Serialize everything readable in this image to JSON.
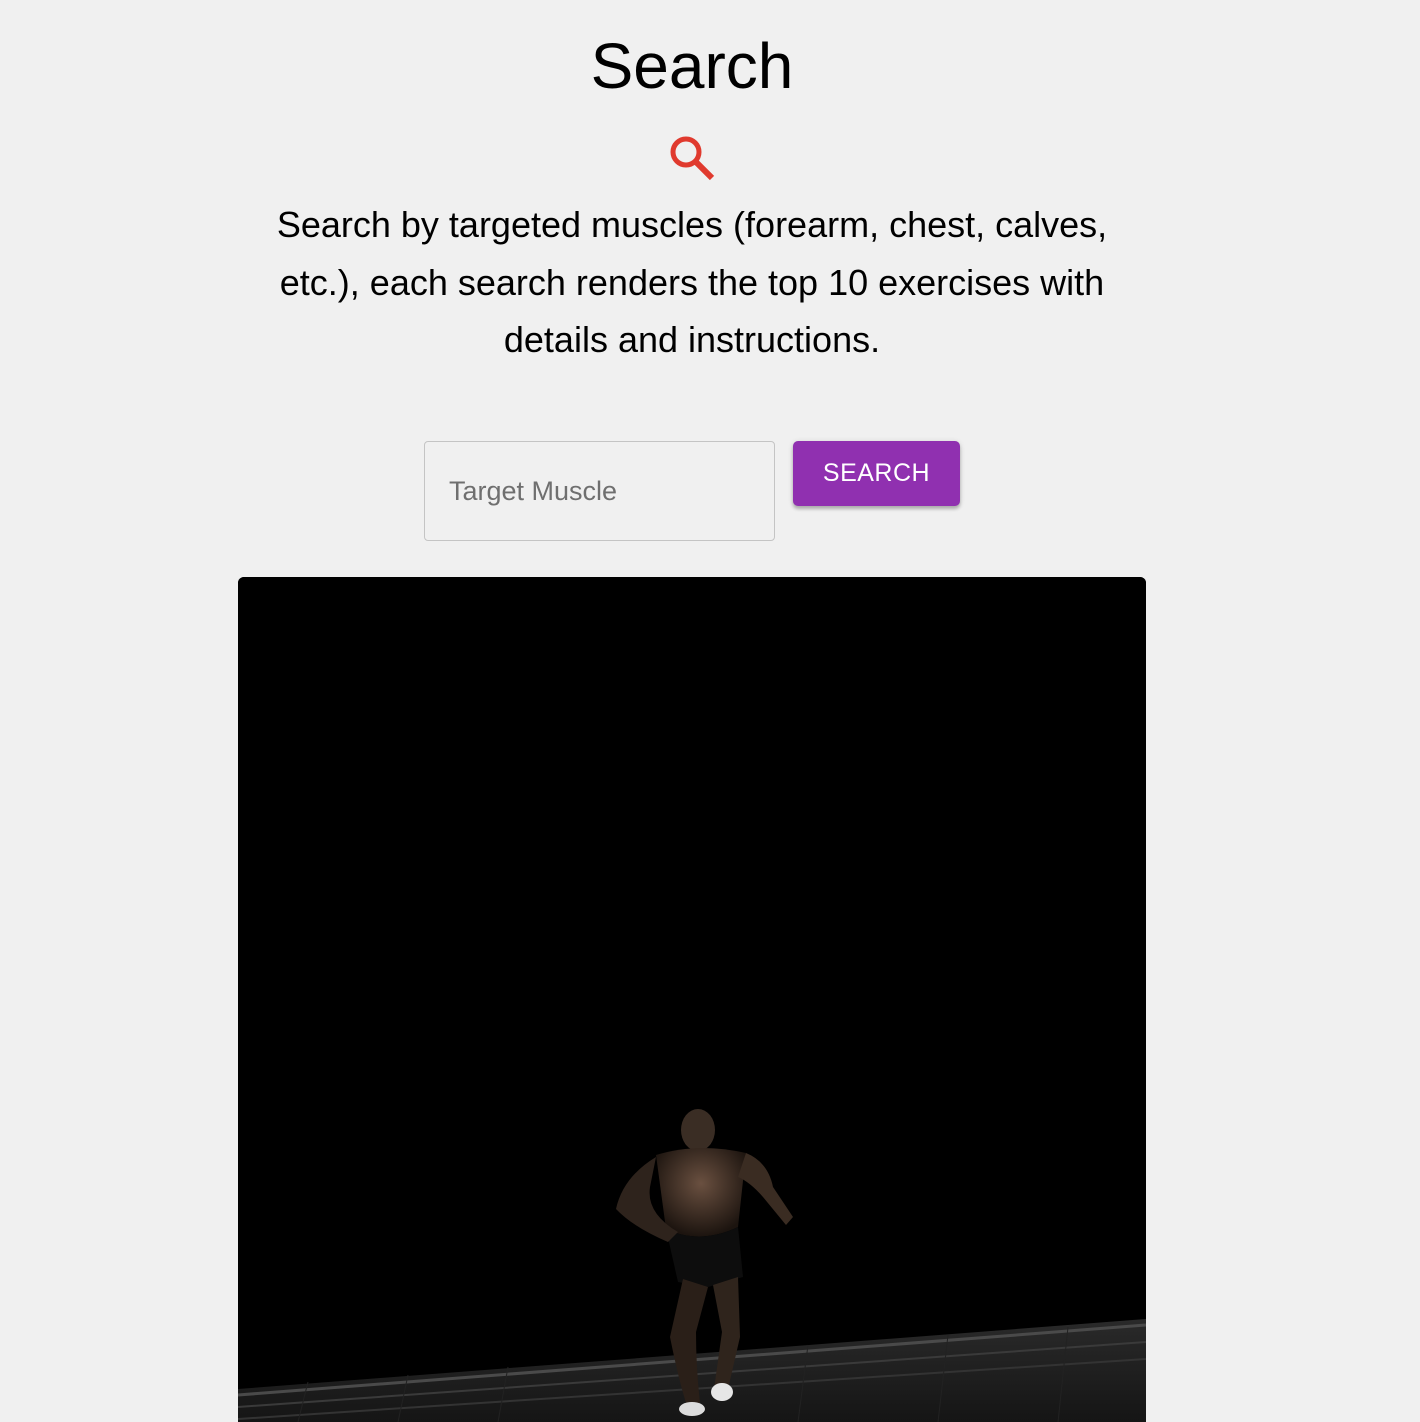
{
  "header": {
    "title": "Search",
    "icon": "search-icon",
    "icon_color": "#e03a2e"
  },
  "intro": {
    "description": "Search by targeted muscles (forearm, chest, calves, etc.), each search renders the top 10 exercises with details and instructions."
  },
  "search": {
    "input_value": "",
    "placeholder": "Target Muscle",
    "button_label": "SEARCH",
    "button_color": "#9030b0"
  },
  "hero": {
    "alt": "Athlete running up stairs in the dark"
  }
}
